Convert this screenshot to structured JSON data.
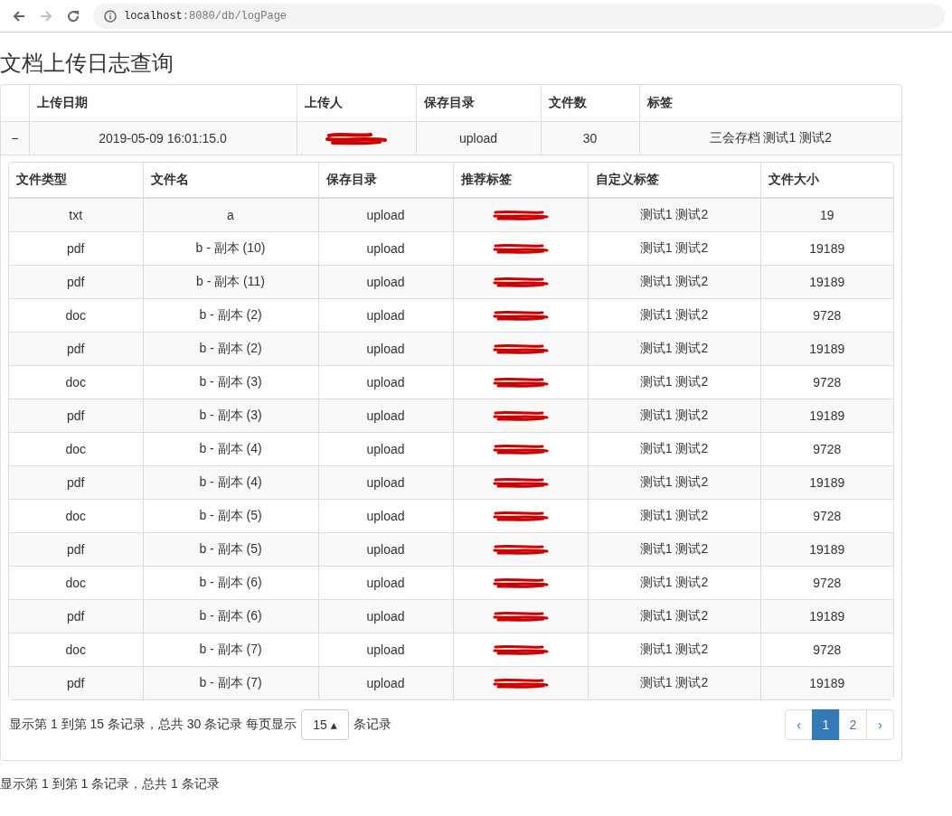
{
  "browser": {
    "url_host": "localhost",
    "url_path": ":8080/db/logPage"
  },
  "title": "文档上传日志查询",
  "log_table": {
    "columns": [
      "上传日期",
      "上传人",
      "保存目录",
      "文件数",
      "标签"
    ],
    "rows": [
      {
        "toggle": "−",
        "expanded": true,
        "date": "2019-05-09 16:01:15.0",
        "dir": "upload",
        "count": "30",
        "tags": "三会存档 测试1 测试2"
      }
    ]
  },
  "file_table": {
    "columns": [
      "文件类型",
      "文件名",
      "保存目录",
      "推荐标签",
      "自定义标签",
      "文件大小"
    ],
    "rows": [
      {
        "type": "txt",
        "name": "a",
        "dir": "upload",
        "custom": "测试1 测试2",
        "size": "19"
      },
      {
        "type": "pdf",
        "name": "b - 副本 (10)",
        "dir": "upload",
        "custom": "测试1 测试2",
        "size": "19189"
      },
      {
        "type": "pdf",
        "name": "b - 副本 (11)",
        "dir": "upload",
        "custom": "测试1 测试2",
        "size": "19189"
      },
      {
        "type": "doc",
        "name": "b - 副本 (2)",
        "dir": "upload",
        "custom": "测试1 测试2",
        "size": "9728"
      },
      {
        "type": "pdf",
        "name": "b - 副本 (2)",
        "dir": "upload",
        "custom": "测试1 测试2",
        "size": "19189"
      },
      {
        "type": "doc",
        "name": "b - 副本 (3)",
        "dir": "upload",
        "custom": "测试1 测试2",
        "size": "9728"
      },
      {
        "type": "pdf",
        "name": "b - 副本 (3)",
        "dir": "upload",
        "custom": "测试1 测试2",
        "size": "19189"
      },
      {
        "type": "doc",
        "name": "b - 副本 (4)",
        "dir": "upload",
        "custom": "测试1 测试2",
        "size": "9728"
      },
      {
        "type": "pdf",
        "name": "b - 副本 (4)",
        "dir": "upload",
        "custom": "测试1 测试2",
        "size": "19189"
      },
      {
        "type": "doc",
        "name": "b - 副本 (5)",
        "dir": "upload",
        "custom": "测试1 测试2",
        "size": "9728"
      },
      {
        "type": "pdf",
        "name": "b - 副本 (5)",
        "dir": "upload",
        "custom": "测试1 测试2",
        "size": "19189"
      },
      {
        "type": "doc",
        "name": "b - 副本 (6)",
        "dir": "upload",
        "custom": "测试1 测试2",
        "size": "9728"
      },
      {
        "type": "pdf",
        "name": "b - 副本 (6)",
        "dir": "upload",
        "custom": "测试1 测试2",
        "size": "19189"
      },
      {
        "type": "doc",
        "name": "b - 副本 (7)",
        "dir": "upload",
        "custom": "测试1 测试2",
        "size": "9728"
      },
      {
        "type": "pdf",
        "name": "b - 副本 (7)",
        "dir": "upload",
        "custom": "测试1 测试2",
        "size": "19189"
      }
    ]
  },
  "file_pager": {
    "info": "显示第 1 到第 15 条记录，总共 30 条记录 每页显示",
    "page_size": "15 ▴",
    "suffix": "条记录",
    "pages": [
      {
        "label": "‹",
        "selected": false
      },
      {
        "label": "1",
        "selected": true
      },
      {
        "label": "2",
        "selected": false
      },
      {
        "label": "›",
        "selected": false
      }
    ]
  },
  "log_pager": {
    "info": "显示第 1 到第 1 条记录，总共 1 条记录"
  }
}
